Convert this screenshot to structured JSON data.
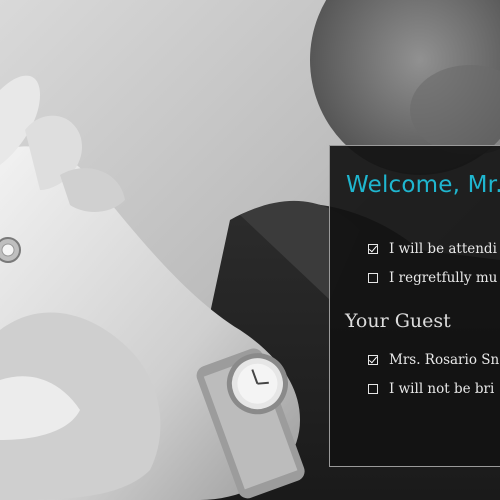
{
  "rsvp": {
    "welcome": "Welcome, Mr.",
    "attendance_options": [
      {
        "label": "I will be attendi",
        "checked": true
      },
      {
        "label": "I regretfully mu",
        "checked": false
      }
    ],
    "guest_section_title": "Your Guest",
    "guest_options": [
      {
        "label": "Mrs. Rosario Sn",
        "checked": true
      },
      {
        "label": "I will not be bri",
        "checked": false
      }
    ]
  },
  "colors": {
    "accent": "#1fb6cf",
    "panel_bg": "#121212",
    "text": "#e8e8e8"
  },
  "background": {
    "description_icon": "photo-hands-ring-watch"
  }
}
